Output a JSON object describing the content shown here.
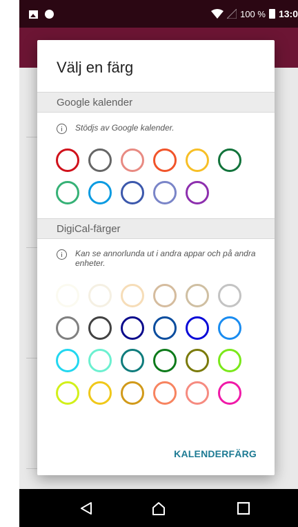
{
  "status_bar": {
    "wifi_icon": "wifi-icon",
    "battery_text": "100 %",
    "time": "13:0"
  },
  "dialog": {
    "title": "Välj en färg",
    "action_label": "KALENDERFÄRG",
    "sections": [
      {
        "header": "Google kalender",
        "info": "Stödjs av Google kalender.",
        "rows": [
          [
            "#d0111b",
            "#666666",
            "#e88a82",
            "#f1542a",
            "#f7bf26",
            "#12733b"
          ],
          [
            "#36b176",
            "#0b9be1",
            "#3c58ac",
            "#7a85c8",
            "#8d2fae"
          ]
        ]
      },
      {
        "header": "DigiCal-färger",
        "info": "Kan se annorlunda ut i andra appar och på andra enheter.",
        "rows": [
          [
            "#fbfaf0",
            "#f5f0e3",
            "#f6ddb8",
            "#d5bc9e",
            "#cfbfa2",
            "#c3c3c3"
          ],
          [
            "#808080",
            "#424242",
            "#0c0c8c",
            "#0b4d9e",
            "#0a0ad8",
            "#1a8cf0"
          ],
          [
            "#22d7f0",
            "#6cf0d0",
            "#0f7c7c",
            "#0d7a1a",
            "#7a7a0a",
            "#7ae81a"
          ],
          [
            "#d2f01a",
            "#f0c81a",
            "#d19a1a",
            "#f78460",
            "#f68b80",
            "#f01aa8"
          ]
        ]
      }
    ]
  },
  "nav": {
    "back_icon": "back-triangle-icon",
    "home_icon": "home-icon",
    "recents_icon": "recents-square-icon"
  }
}
